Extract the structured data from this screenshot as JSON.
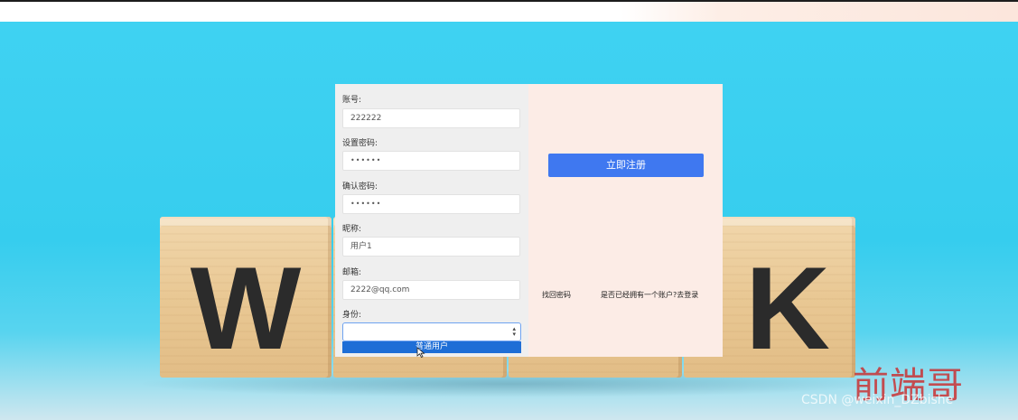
{
  "cubes": {
    "w_letter": "W",
    "k_letter": "K"
  },
  "form": {
    "account_label": "账号:",
    "account_value": "222222",
    "password_label": "设置密码:",
    "password_value": "••••••",
    "confirm_label": "确认密码:",
    "confirm_value": "••••••",
    "nickname_label": "昵称:",
    "nickname_value": "用户1",
    "email_label": "邮箱:",
    "email_value": "2222@qq.com",
    "role_label": "身份:",
    "role_value": "",
    "role_dropdown_option": "普通用户"
  },
  "right": {
    "register_button": "立即注册",
    "find_password_link": "找回密码",
    "login_link": "是否已经拥有一个账户?去登录"
  },
  "watermark": {
    "chinese": "前端哥",
    "csdn": "CSDN @weixin_DZbishe"
  },
  "colors": {
    "primary": "#3f78f0",
    "dropdown_highlight": "#1e6ed6",
    "watermark_red": "#cd2323"
  }
}
